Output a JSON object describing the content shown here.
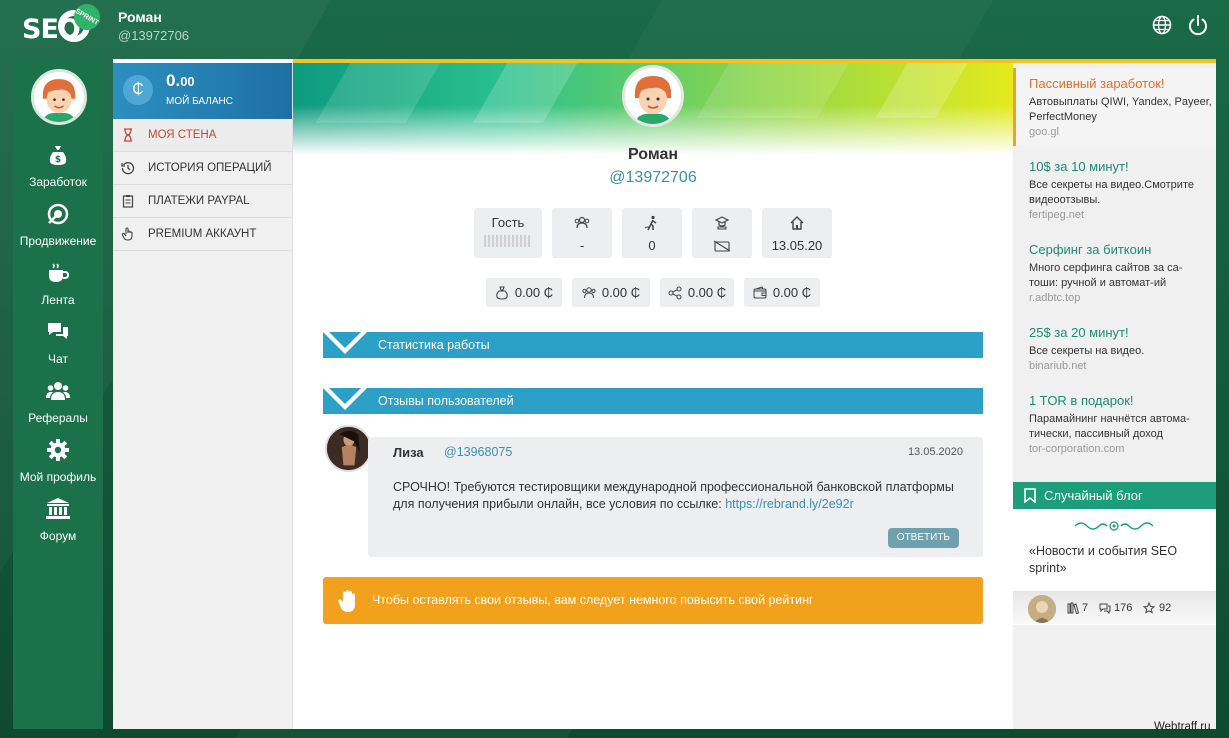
{
  "header": {
    "logo_text": "SEO",
    "logo_badge": "SPRINT",
    "user_name": "Роман",
    "user_id": "@13972706",
    "icons": [
      "globe-icon",
      "power-icon"
    ]
  },
  "left_nav": [
    {
      "label": "Заработок",
      "icon": "money-bag-icon"
    },
    {
      "label": "Продвижение",
      "icon": "target-icon"
    },
    {
      "label": "Лента",
      "icon": "coffee-cup-icon"
    },
    {
      "label": "Чат",
      "icon": "chat-bubbles-icon"
    },
    {
      "label": "Рефералы",
      "icon": "users-icon"
    },
    {
      "label": "Мой профиль",
      "icon": "gear-icon"
    },
    {
      "label": "Форум",
      "icon": "institution-icon"
    }
  ],
  "balance": {
    "symbol": "₵",
    "amount_main": "0.",
    "amount_cents": "00",
    "label": "МОЙ БАЛАНС"
  },
  "menu": [
    {
      "label": "Моя стена",
      "icon": "hourglass-icon",
      "active": true
    },
    {
      "label": "История операций",
      "icon": "history-icon",
      "active": false
    },
    {
      "label": "Платежи PayPal",
      "icon": "clipboard-icon",
      "active": false
    },
    {
      "label": "Premium аккаунт",
      "icon": "hand-pointer-icon",
      "active": false
    }
  ],
  "profile": {
    "name": "Роман",
    "id": "@13972706",
    "stats": [
      {
        "text": "Гость",
        "icon": "none"
      },
      {
        "text": "-",
        "icon": "users-icon"
      },
      {
        "text": "0",
        "icon": "hiking-icon"
      },
      {
        "text": "",
        "icon": "graduation-icon"
      },
      {
        "text": "13.05.20",
        "icon": "home-icon"
      }
    ],
    "pills": [
      {
        "text": "0.00 ₵",
        "icon": "money-bag-icon"
      },
      {
        "text": "0.00 ₵",
        "icon": "users-icon"
      },
      {
        "text": "0.00 ₵",
        "icon": "share-icon"
      },
      {
        "text": "0.00 ₵",
        "icon": "wallet-icon"
      }
    ]
  },
  "sections": {
    "stats_title": "Статистика работы",
    "reviews_title": "Отзывы пользователей"
  },
  "review": {
    "author": "Лиза",
    "author_id": "@13968075",
    "date": "13.05.2020",
    "text": "СРОЧНО! Требуются тестировщики международной профессиональной банковской платформы для получения прибыли онлайн, все условия по ссылке: ",
    "link": "https://rebrand.ly/2e92r",
    "reply_label": "ОТВЕТИТЬ"
  },
  "warning": {
    "text": "Чтобы оставлять свои отзывы, вам следует немного повысить свой рейтинг"
  },
  "ads": [
    {
      "title": "Пассивный заработок!",
      "desc": "Автовыплаты QIWI, Yandex, Payeer, PerfectMoney",
      "url": "goo.gl"
    },
    {
      "title": "10$ за 10 минут!",
      "desc": "Все секреты на видео.Смотрите видеоотзывы.",
      "url": "fertipeg.net"
    },
    {
      "title": "Серфинг за биткоин",
      "desc": "Много серфинга сайтов за са-тоши: ручной и автомат-ий",
      "url": "r.adbtc.top"
    },
    {
      "title": "25$ за 20 минут!",
      "desc": "Все секреты на видео.",
      "url": "binariub.net"
    },
    {
      "title": "1 TOR в подарок!",
      "desc": "Парамайнинг начнётся автома-тически, пассивный доход",
      "url": "tor-corporation.com"
    }
  ],
  "blog": {
    "title": "Случайный блог",
    "post": "«Новости и события SEO sprint»",
    "views": "7",
    "comments": "176",
    "rating": "92"
  },
  "watermark": "Webtraff.ru",
  "colors": {
    "brand_green": "#1b7149",
    "accent_blue": "#2ca0c7",
    "warning_orange": "#f2a11d",
    "active_red": "#c8462f"
  }
}
